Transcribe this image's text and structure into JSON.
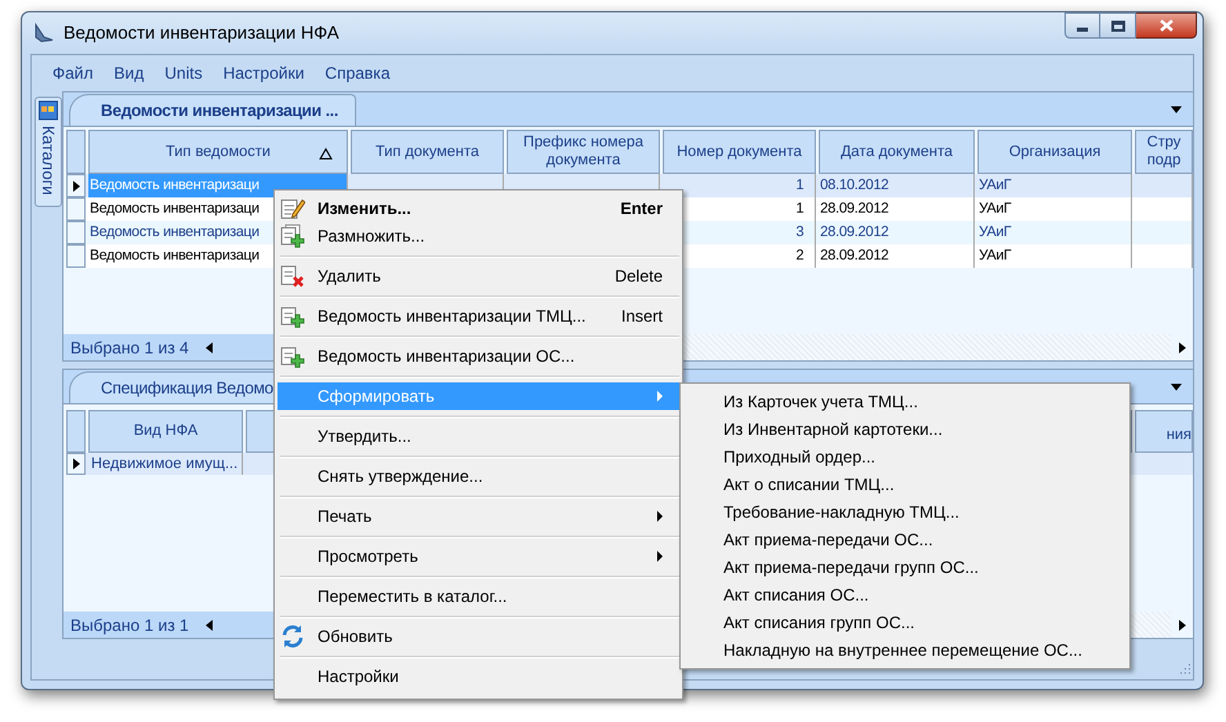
{
  "window": {
    "title": "Ведомости инвентаризации НФА"
  },
  "menu_bar": [
    "Файл",
    "Вид",
    "Units",
    "Настройки",
    "Справка"
  ],
  "side_tab": {
    "label": "Каталоги"
  },
  "top_panel": {
    "tab": "Ведомости инвентаризации ...",
    "columns": [
      {
        "label": "Тип ведомости",
        "sorted": true
      },
      {
        "label": "Тип документа",
        "sorted": false
      },
      {
        "label": "Префикс номера документа",
        "sorted": false
      },
      {
        "label": "Номер документа",
        "sorted": false
      },
      {
        "label": "Дата документа",
        "sorted": false
      },
      {
        "label": "Организация",
        "sorted": false
      },
      {
        "label": "Стру подр",
        "sorted": false
      }
    ],
    "rows": [
      {
        "selected": true,
        "cells": [
          "Ведомость инвентаризаци",
          "",
          "",
          "1",
          "08.10.2012",
          "УАиГ",
          ""
        ]
      },
      {
        "selected": false,
        "cells": [
          "Ведомость инвентаризаци",
          "",
          "",
          "1",
          "28.09.2012",
          "УАиГ",
          ""
        ]
      },
      {
        "selected": false,
        "cells": [
          "Ведомость инвентаризаци",
          "",
          "",
          "3",
          "28.09.2012",
          "УАиГ",
          ""
        ]
      },
      {
        "selected": false,
        "cells": [
          "Ведомость инвентаризаци",
          "",
          "",
          "2",
          "28.09.2012",
          "УАиГ",
          ""
        ]
      }
    ],
    "status": "Выбрано 1 из 4"
  },
  "bottom_panel": {
    "tab": "Спецификация Ведомо",
    "columns": [
      {
        "label": "Вид НФА"
      },
      {
        "label": "ния"
      }
    ],
    "rows": [
      {
        "selected": true,
        "cells": [
          "Недвижимое имущ..."
        ]
      }
    ],
    "status": "Выбрано 1 из 1"
  },
  "context_menu": {
    "sections": [
      [
        {
          "kind": "edit",
          "label": "Изменить...",
          "shortcut": "Enter",
          "default": true,
          "selected": false,
          "submenu": false
        },
        {
          "kind": "copy",
          "label": "Размножить...",
          "default": false,
          "selected": false,
          "submenu": false
        }
      ],
      [
        {
          "kind": "delete",
          "label": "Удалить",
          "shortcut": "Delete",
          "default": false,
          "selected": false,
          "submenu": false
        }
      ],
      [
        {
          "kind": "add",
          "label": "Ведомость инвентаризации ТМЦ...",
          "shortcut": "Insert",
          "default": false,
          "selected": false,
          "submenu": false
        }
      ],
      [
        {
          "kind": "add",
          "label": "Ведомость инвентаризации ОС...",
          "default": false,
          "selected": false,
          "submenu": false
        }
      ],
      [
        {
          "kind": "plain",
          "label": "Сформировать",
          "default": false,
          "selected": true,
          "submenu": true
        }
      ],
      [
        {
          "kind": "plain",
          "label": "Утвердить...",
          "default": false,
          "selected": false,
          "submenu": false
        }
      ],
      [
        {
          "kind": "plain",
          "label": "Снять утверждение...",
          "default": false,
          "selected": false,
          "submenu": false
        }
      ],
      [
        {
          "kind": "plain",
          "label": "Печать",
          "default": false,
          "selected": false,
          "submenu": true
        }
      ],
      [
        {
          "kind": "plain",
          "label": "Просмотреть",
          "default": false,
          "selected": false,
          "submenu": true
        }
      ],
      [
        {
          "kind": "plain",
          "label": "Переместить в каталог...",
          "default": false,
          "selected": false,
          "submenu": false
        }
      ],
      [
        {
          "kind": "refresh",
          "label": "Обновить",
          "default": false,
          "selected": false,
          "submenu": false
        }
      ],
      [
        {
          "kind": "plain",
          "label": "Настройки",
          "default": false,
          "selected": false,
          "submenu": false
        }
      ]
    ]
  },
  "submenu": [
    "Из Карточек учета ТМЦ...",
    "Из Инвентарной картотеки...",
    "Приходный ордер...",
    "Акт о списании ТМЦ...",
    "Требование-накладную ТМЦ...",
    "Акт приема-передачи ОС...",
    "Акт приема-передачи групп ОС...",
    "Акт списания ОС...",
    "Акт списания групп ОС...",
    "Накладную на внутреннее перемещение ОС..."
  ]
}
